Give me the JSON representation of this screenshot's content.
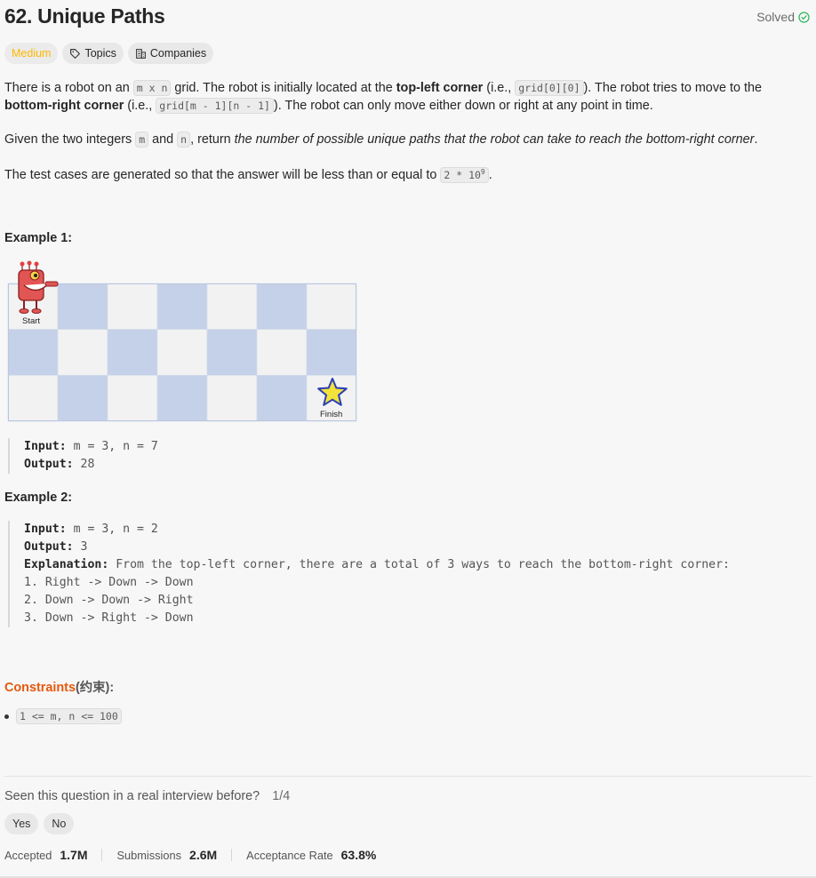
{
  "problem": {
    "title": "62. Unique Paths",
    "status": "Solved",
    "difficulty": "Medium",
    "topics_label": "Topics",
    "companies_label": "Companies"
  },
  "description": {
    "p1_a": "There is a robot on an ",
    "p1_code1": "m x n",
    "p1_b": " grid. The robot is initially located at the ",
    "p1_bold1": "top-left corner",
    "p1_c": " (i.e., ",
    "p1_code2": "grid[0][0]",
    "p1_d": "). The robot tries to move to the ",
    "p1_bold2": "bottom-right corner",
    "p1_e": " (i.e., ",
    "p1_code3": "grid[m - 1][n - 1]",
    "p1_f": "). The robot can only move either down or right at any point in time.",
    "p2_a": "Given the two integers ",
    "p2_code1": "m",
    "p2_b": " and ",
    "p2_code2": "n",
    "p2_c": ", return ",
    "p2_italic": "the number of possible unique paths that the robot can take to reach the bottom-right corner",
    "p2_d": ".",
    "p3_a": "The test cases are generated so that the answer will be less than or equal to ",
    "p3_code": "2 * 10",
    "p3_sup": "9",
    "p3_b": "."
  },
  "example1": {
    "title": "Example 1:",
    "start_label": "Start",
    "finish_label": "Finish",
    "input_label": "Input:",
    "input_value": " m = 3, n = 7",
    "output_label": "Output:",
    "output_value": " 28"
  },
  "example2": {
    "title": "Example 2:",
    "input_label": "Input:",
    "input_value": " m = 3, n = 2",
    "output_label": "Output:",
    "output_value": " 3",
    "explanation_label": "Explanation:",
    "explanation_value": " From the top-left corner, there are a total of 3 ways to reach the bottom-right corner:",
    "line1": "1. Right -> Down -> Down",
    "line2": "2. Down -> Down -> Right",
    "line3": "3. Down -> Right -> Down"
  },
  "constraints": {
    "title": "Constraints",
    "title_cn": "(约束):",
    "item1": "1 <= m, n <= 100"
  },
  "interview": {
    "question": "Seen this question in a real interview before?",
    "count": "1/4",
    "yes": "Yes",
    "no": "No"
  },
  "stats": {
    "accepted_label": "Accepted",
    "accepted_value": "1.7M",
    "submissions_label": "Submissions",
    "submissions_value": "2.6M",
    "rate_label": "Acceptance Rate",
    "rate_value": "63.8%"
  },
  "colors": {
    "medium": "#ffb800",
    "solved_check": "#2db55d",
    "grid_blue": "#c5d1e8",
    "constraints_orange": "#e5590d"
  }
}
